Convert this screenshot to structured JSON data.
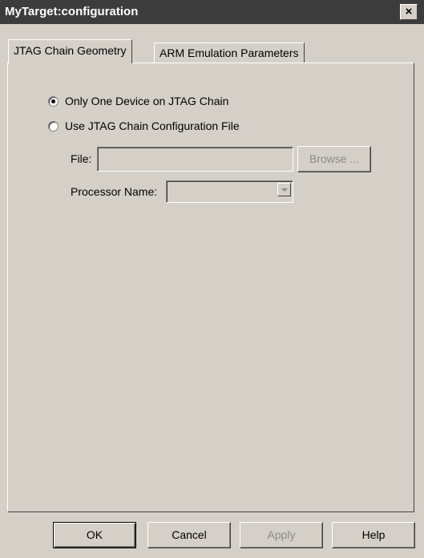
{
  "window": {
    "title": "MyTarget:configuration",
    "close_glyph": "×"
  },
  "tabs": [
    {
      "label": "JTAG Chain Geometry",
      "active": true
    },
    {
      "label": "ARM Emulation Parameters",
      "active": false
    }
  ],
  "options": {
    "only_one_device": {
      "label": "Only One Device on JTAG Chain",
      "checked": true
    },
    "use_config_file": {
      "label": "Use JTAG Chain Configuration File",
      "checked": false
    }
  },
  "file": {
    "label": "File:",
    "value": "",
    "browse_label": "Browse ..."
  },
  "processor": {
    "label": "Processor Name:",
    "value": ""
  },
  "buttons": {
    "ok": "OK",
    "cancel": "Cancel",
    "apply": "Apply",
    "help": "Help"
  },
  "colors": {
    "dialog_bg": "#d4d0c8",
    "titlebar_bg": "#3c3c3c",
    "disabled_text": "#8a8a8a"
  },
  "icons": {
    "close": "close-icon",
    "dropdown": "chevron-down-icon"
  }
}
